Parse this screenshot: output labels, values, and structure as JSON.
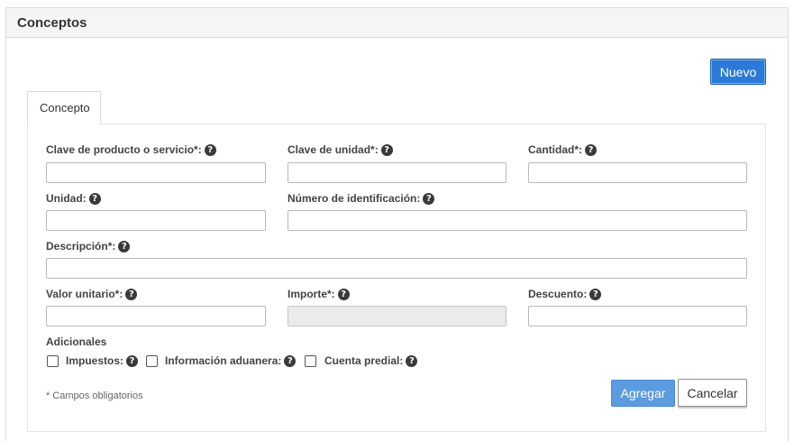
{
  "panel": {
    "title": "Conceptos"
  },
  "toolbar": {
    "new_label": "Nuevo"
  },
  "tabs": [
    {
      "label": "Concepto"
    }
  ],
  "form": {
    "fields": {
      "clave_producto": {
        "label": "Clave de producto o servicio*:",
        "value": ""
      },
      "clave_unidad": {
        "label": "Clave de unidad*:",
        "value": ""
      },
      "cantidad": {
        "label": "Cantidad*:",
        "value": ""
      },
      "unidad": {
        "label": "Unidad:",
        "value": ""
      },
      "numero_identificacion": {
        "label": "Número de identificación:",
        "value": ""
      },
      "descripcion": {
        "label": "Descripción*:",
        "value": ""
      },
      "valor_unitario": {
        "label": "Valor unitario*:",
        "value": ""
      },
      "importe": {
        "label": "Importe*:",
        "value": ""
      },
      "descuento": {
        "label": "Descuento:",
        "value": ""
      }
    },
    "adicionales": {
      "title": "Adicionales",
      "impuestos": "Impuestos:",
      "informacion_aduanera": "Información aduanera:",
      "cuenta_predial": "Cuenta predial:"
    },
    "required_note": "* Campos obligatorios",
    "add_label": "Agregar",
    "cancel_label": "Cancelar"
  },
  "help_glyph": "?",
  "colors": {
    "primary": "#2b7ad8",
    "primary_light": "#5b9be0",
    "header_bg": "#f5f5f5"
  }
}
